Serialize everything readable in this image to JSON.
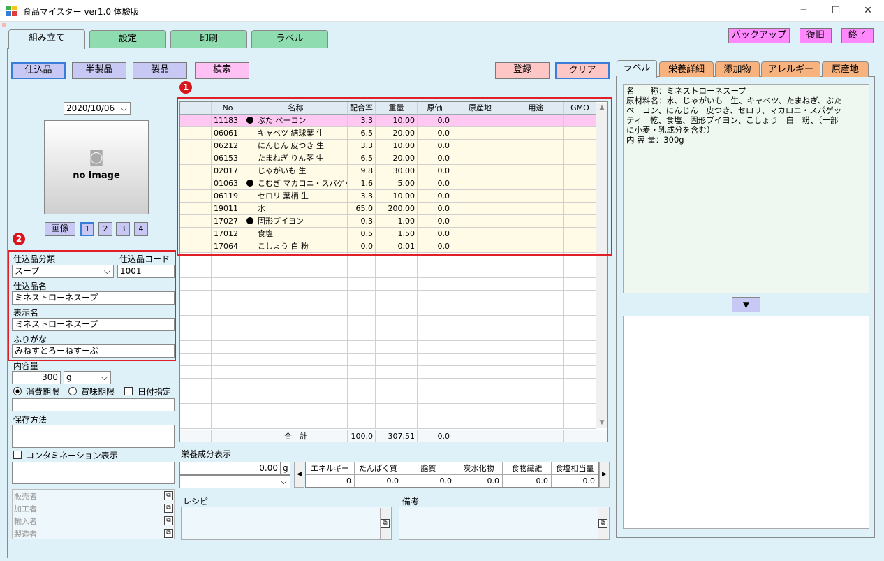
{
  "window": {
    "title": "食品マイスター ver1.0 体験版"
  },
  "tabs": [
    {
      "label": "組み立て"
    },
    {
      "label": "設定"
    },
    {
      "label": "印刷"
    },
    {
      "label": "ラベル"
    }
  ],
  "top_buttons": {
    "backup": "バックアップ",
    "restore": "復旧",
    "exit": "終了"
  },
  "mode_buttons": {
    "shikomi": "仕込品",
    "hanseihin": "半製品",
    "seihin": "製品",
    "kensaku": "検索"
  },
  "actions": {
    "register": "登録",
    "clear": "クリア"
  },
  "markers": {
    "one": "1",
    "two": "2"
  },
  "left": {
    "date": "2020/10/06",
    "image_placeholder": "no image",
    "image_button": "画像",
    "image_pages": [
      "1",
      "2",
      "3",
      "4"
    ],
    "category_label": "仕込品分類",
    "category_value": "スープ",
    "code_label": "仕込品コード",
    "code_value": "1001",
    "name_label": "仕込品名",
    "name_value": "ミネストローネスープ",
    "display_label": "表示名",
    "display_value": "ミネストローネスープ",
    "furigana_label": "ふりがな",
    "furigana_value": "みねすとろーねすーぷ",
    "volume_label": "内容量",
    "volume_value": "300",
    "volume_unit": "g",
    "expiry_consume": "消費期限",
    "expiry_best": "賞味期限",
    "date_specify": "日付指定",
    "storage_label": "保存方法",
    "contamination_label": "コンタミネーション表示",
    "parties": [
      "販売者",
      "加工者",
      "輸入者",
      "製造者"
    ]
  },
  "grid": {
    "columns": [
      "No",
      "名称",
      "配合率",
      "重量",
      "原価",
      "原産地",
      "用途",
      "GMO"
    ],
    "rows": [
      {
        "no": "11183",
        "dot": true,
        "name": "ぶた ベーコン",
        "ratio": "3.3",
        "weight": "10.00",
        "cost": "0.0"
      },
      {
        "no": "06061",
        "dot": false,
        "name": "キャベツ 結球葉 生",
        "ratio": "6.5",
        "weight": "20.00",
        "cost": "0.0"
      },
      {
        "no": "06212",
        "dot": false,
        "name": "にんじん 皮つき 生",
        "ratio": "3.3",
        "weight": "10.00",
        "cost": "0.0"
      },
      {
        "no": "06153",
        "dot": false,
        "name": "たまねぎ りん茎 生",
        "ratio": "6.5",
        "weight": "20.00",
        "cost": "0.0"
      },
      {
        "no": "02017",
        "dot": false,
        "name": "じゃがいも 生",
        "ratio": "9.8",
        "weight": "30.00",
        "cost": "0.0"
      },
      {
        "no": "01063",
        "dot": true,
        "name": "こむぎ マカロニ・スパゲッ",
        "ratio": "1.6",
        "weight": "5.00",
        "cost": "0.0"
      },
      {
        "no": "06119",
        "dot": false,
        "name": "セロリ 葉柄 生",
        "ratio": "3.3",
        "weight": "10.00",
        "cost": "0.0"
      },
      {
        "no": "19011",
        "dot": false,
        "name": "水",
        "ratio": "65.0",
        "weight": "200.00",
        "cost": "0.0"
      },
      {
        "no": "17027",
        "dot": true,
        "name": "固形ブイヨン",
        "ratio": "0.3",
        "weight": "1.00",
        "cost": "0.0"
      },
      {
        "no": "17012",
        "dot": false,
        "name": "食塩",
        "ratio": "0.5",
        "weight": "1.50",
        "cost": "0.0"
      },
      {
        "no": "17064",
        "dot": false,
        "name": "こしょう 白 粉",
        "ratio": "0.0",
        "weight": "0.01",
        "cost": "0.0"
      }
    ],
    "total": {
      "label": "合　計",
      "ratio": "100.0",
      "weight": "307.51",
      "cost": "0.0"
    }
  },
  "nutrition": {
    "label": "栄養成分表示",
    "amount": "0.00",
    "unit": "g",
    "columns": [
      "エネルギー",
      "たんぱく質",
      "脂質",
      "炭水化物",
      "食物繊維",
      "食塩相当量"
    ],
    "values": [
      "0",
      "0.0",
      "0.0",
      "0.0",
      "0.0",
      "0.0"
    ]
  },
  "recipe_label": "レシピ",
  "notes_label": "備考",
  "right": {
    "tabs": [
      "ラベル",
      "栄養詳細",
      "添加物",
      "アレルギー",
      "原産地"
    ],
    "label_lines": [
      "名　　称：ミネストローネスープ",
      "原材料名：水、じゃがいも　生、キャベツ、たまねぎ、ぶた",
      "ベーコン、にんじん　皮つき、セロリ、マカロニ・スパゲッ",
      "ティ　乾、食塩、固形ブイヨン、こしょう　白　粉、（一部",
      "に小麦・乳成分を含む）",
      "内 容 量：300g"
    ]
  }
}
